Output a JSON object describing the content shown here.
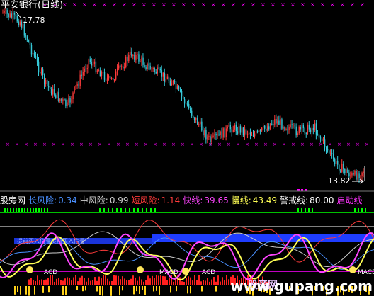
{
  "window": {
    "title": "平安银行(日线)"
  },
  "price": {
    "high_label": "17.78",
    "low_label": "13.82"
  },
  "indicator": {
    "name": "股旁网",
    "items": [
      {
        "label": "长风险:",
        "value": "0.34",
        "color": "#4a90ff"
      },
      {
        "label": "中风险:",
        "value": "0.99",
        "color": "#cfcfcf"
      },
      {
        "label": "短风险:",
        "value": "1.14",
        "color": "#ff3b3b"
      },
      {
        "label": "快线:",
        "value": "39.65",
        "color": "#ff44ff"
      },
      {
        "label": "慢线:",
        "value": "43.49",
        "color": "#ffff55"
      },
      {
        "label": "警戒线:",
        "value": "80.00",
        "color": "#ffffff"
      }
    ],
    "start_label": "启动线",
    "start_color": "#ff33ff",
    "macd_labels": [
      "ACD",
      "MACD",
      "ACD",
      "MACD"
    ],
    "band_label": "提前买入信号提前买入信号"
  },
  "watermark": {
    "text_cn": "股旁网",
    "text_url": "www.gupang.com"
  },
  "colors": {
    "up": "#ff3b3b",
    "down": "#36c8d8",
    "accent": "#ff00ff",
    "signal": "#00ff00",
    "band": "#1f3dff"
  }
}
